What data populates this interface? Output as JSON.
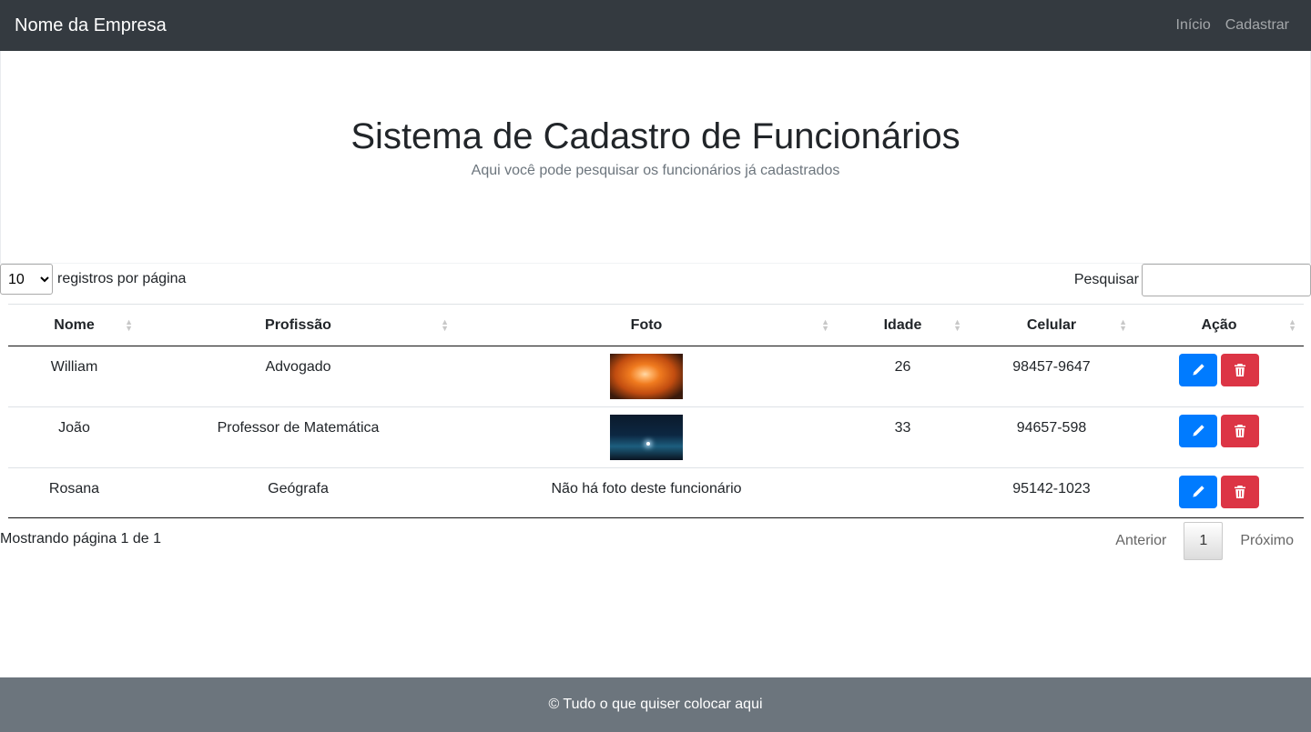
{
  "navbar": {
    "brand": "Nome da Empresa",
    "links": [
      "Início",
      "Cadastrar"
    ]
  },
  "hero": {
    "title": "Sistema de Cadastro de Funcionários",
    "subtitle": "Aqui você pode pesquisar os funcionários já cadastrados"
  },
  "table_controls": {
    "length_value": "10",
    "length_label": "registros por página",
    "search_label": "Pesquisar",
    "search_value": ""
  },
  "table": {
    "columns": [
      "Nome",
      "Profissão",
      "Foto",
      "Idade",
      "Celular",
      "Ação"
    ],
    "rows": [
      {
        "nome": "William",
        "profissao": "Advogado",
        "foto": "",
        "idade": "26",
        "celular": "98457-9647"
      },
      {
        "nome": "João",
        "profissao": "Professor de Matemática",
        "foto": "",
        "idade": "33",
        "celular": "94657-598"
      },
      {
        "nome": "Rosana",
        "profissao": "Geógrafa",
        "foto": "Não há foto deste funcionário",
        "idade": "",
        "celular": "95142-1023"
      }
    ]
  },
  "pagination": {
    "info": "Mostrando página 1 de 1",
    "previous": "Anterior",
    "current": "1",
    "next": "Próximo"
  },
  "footer": {
    "text": "© Tudo o que quiser colocar aqui"
  },
  "colors": {
    "navbar": "#343a40",
    "edit_button": "#007bff",
    "delete_button": "#dc3545",
    "footer": "#6c757d"
  }
}
